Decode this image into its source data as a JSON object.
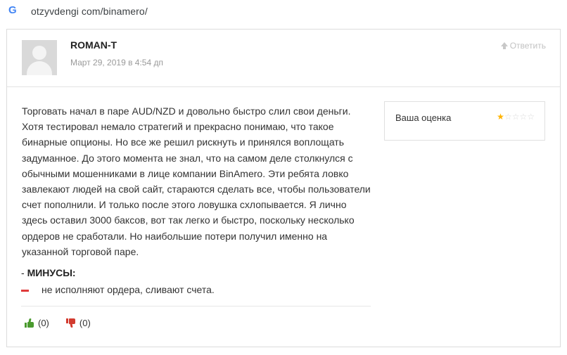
{
  "browser": {
    "url": "otzyvdengi com/binamero/",
    "favicon": "google-g-icon"
  },
  "review": {
    "author": "ROMAN-T",
    "date": "Март 29, 2019 в 4:54 дп",
    "reply_label": "Ответить",
    "body": "Торговать начал в паре AUD/NZD и довольно быстро слил свои деньги. Хотя тестировал немало стратегий и прекрасно понимаю, что такое бинарные опционы. Но все же решил рискнуть и принялся воплощать задуманное. До этого момента не знал, что на самом деле столкнулся с обычными мошенниками в лице компании BinAmero. Эти ребята ловко завлекают людей на свой сайт, стараются сделать все, чтобы пользователи счет пополнили. И только после этого ловушка схлопывается. Я лично здесь оставил 3000 баксов, вот так легко и быстро, поскольку несколько ордеров не сработали. Но наибольшие потери получил именно на указанной торговой паре.",
    "cons_prefix": "- ",
    "cons_title": "МИНУСЫ:",
    "cons_items": [
      "не исполняют ордера, сливают счета."
    ],
    "likes": "(0)",
    "dislikes": "(0)",
    "rating_label": "Ваша оценка",
    "rating": 1,
    "rating_max": 5
  },
  "colors": {
    "like": "#4a9a2e",
    "dislike": "#d23b2f",
    "minus": "#e03b3b",
    "star": "#ffb300"
  }
}
